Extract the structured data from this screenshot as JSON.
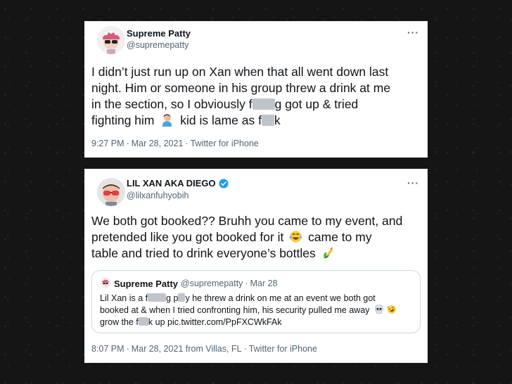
{
  "tweet1": {
    "name": "Supreme Patty",
    "handle": "@supremepatty",
    "more": "···",
    "line1": "I didn’t just run up on Xan when that all went down last",
    "line2": "night. Him or someone in his group threw a drink at me",
    "line3_a": "in the section, so I obviously f",
    "line3_b": "g got up & tried",
    "line4_a": "fighting him",
    "line4_b": "kid is lame as f",
    "line4_c": "k",
    "time": "9:27 PM",
    "date": "Mar 28, 2021",
    "source": "Twitter for iPhone"
  },
  "tweet2": {
    "name": "LIL XAN AKA DIEGO",
    "handle": "@lilxanfuhyobih",
    "more": "···",
    "line1": "We both got booked?? Bruhh you came to my event, and",
    "line2_a": "pretended like you got booked for it",
    "line2_b": "came to my",
    "line3": "table and tried to drink everyone’s bottles",
    "time": "8:07 PM",
    "date": "Mar 28, 2021 from Villas, FL",
    "source": "Twitter for iPhone",
    "quote": {
      "name": "Supreme Patty",
      "handle": "@supremepatty",
      "date": "Mar 28",
      "line1_a": "Lil Xan is a f",
      "line1_b": "g p",
      "line1_c": "y he threw a drink on me at an event we both got",
      "line2": "booked at & when I tried confronting him, his security pulled me away",
      "line3_a": "grow the f",
      "line3_b": "k up pic.twitter.com/PpFXCWkFAk"
    }
  },
  "colors": {
    "verified": "#1d9bf0",
    "secondary_text": "#536471",
    "censor": "#bfc5ca"
  }
}
